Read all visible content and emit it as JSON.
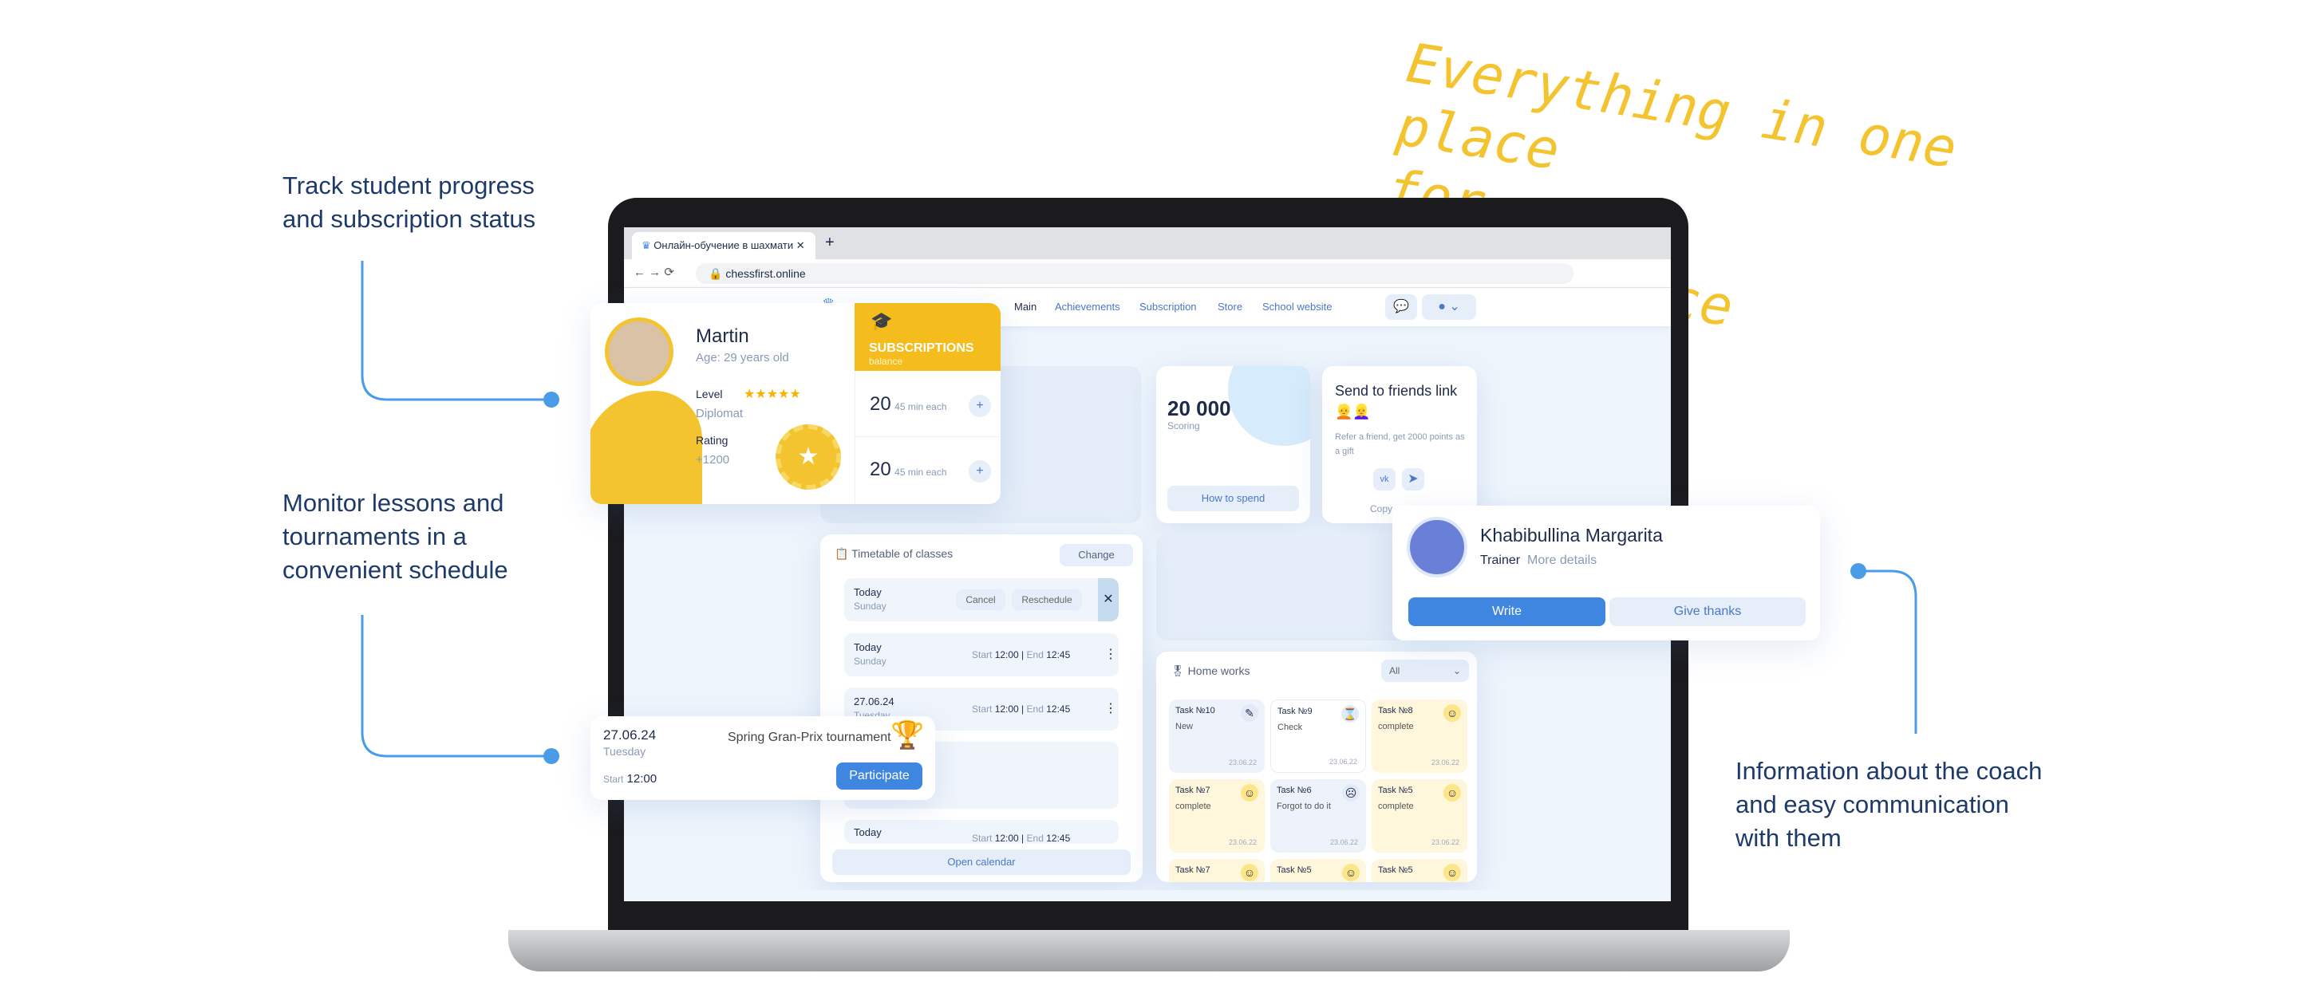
{
  "headline": [
    "Everything in one place",
    "for your convenience"
  ],
  "callouts": {
    "progress": "Track student progress and subscription status",
    "schedule": "Monitor lessons and tournaments in a convenient schedule",
    "coach": "Information about the coach and easy communication with them"
  },
  "browser": {
    "tab_title": "Онлайн-обучение в шахмати",
    "url": "chessfirst.online"
  },
  "nav": [
    "Main",
    "Achievements",
    "Subscription",
    "Store",
    "School website"
  ],
  "profile": {
    "name": "Martin",
    "age": "Age: 29 years old",
    "level_label": "Level",
    "level": "Diplomat",
    "stars": 5,
    "rating_label": "Rating",
    "rating": "+1200"
  },
  "subscriptions": {
    "title": "SUBSCRIPTIONS",
    "subtitle": "balance",
    "items": [
      {
        "count": "20",
        "desc": "45 min each"
      },
      {
        "count": "20",
        "desc": "45 min each"
      }
    ]
  },
  "scoring": {
    "value": "20 000",
    "label": "Scoring",
    "button": "How to spend"
  },
  "friends": {
    "title": "Send to friends link 👱👱‍♀️",
    "text": "Refer a friend, get 2000 points as a gift",
    "copy": "Copy"
  },
  "trainer": {
    "name": "Khabibullina Margarita",
    "role": "Trainer",
    "more": "More details",
    "write": "Write",
    "thanks": "Give thanks"
  },
  "timetable": {
    "title": "Timetable of classes",
    "change": "Change",
    "open": "Open calendar",
    "rows": [
      {
        "day": "Today",
        "weekday": "Sunday",
        "cancel": "Cancel",
        "reschedule": "Reschedule"
      },
      {
        "day": "Today",
        "weekday": "Sunday",
        "start_label": "Start",
        "start": "12:00",
        "end_label": "End",
        "end": "12:45"
      },
      {
        "day": "27.06.24",
        "weekday": "Tuesday",
        "start_label": "Start",
        "start": "12:00",
        "end_label": "End",
        "end": "12:45"
      },
      {
        "day": "Today",
        "start_label": "Start",
        "start": "12:00",
        "end_label": "End",
        "end": "12:45"
      }
    ]
  },
  "tournament": {
    "date": "27.06.24",
    "weekday": "Tuesday",
    "name": "Spring Gran-Prix tournament",
    "start_label": "Start",
    "start": "12:00",
    "button": "Participate"
  },
  "homeworks": {
    "title": "Home works",
    "filter": "All",
    "tasks": [
      {
        "name": "Task №10",
        "status": "New",
        "date": "23.06.22",
        "kind": "new"
      },
      {
        "name": "Task №9",
        "status": "Check",
        "date": "23.06.22",
        "kind": "check"
      },
      {
        "name": "Task №8",
        "status": "complete",
        "date": "23.06.22",
        "kind": "done"
      },
      {
        "name": "Task №7",
        "status": "complete",
        "date": "23.06.22",
        "kind": "done"
      },
      {
        "name": "Task №6",
        "status": "Forgot to do it",
        "date": "23.06.22",
        "kind": "forgot"
      },
      {
        "name": "Task №5",
        "status": "complete",
        "date": "23.06.22",
        "kind": "done"
      },
      {
        "name": "Task №7",
        "status": "",
        "date": "",
        "kind": "done"
      },
      {
        "name": "Task №5",
        "status": "",
        "date": "",
        "kind": "done"
      },
      {
        "name": "Task №5",
        "status": "",
        "date": "",
        "kind": "done"
      }
    ]
  },
  "colors": {
    "accent": "#3f86e0",
    "yellow": "#f4c430",
    "callout": "#4a9be8"
  }
}
